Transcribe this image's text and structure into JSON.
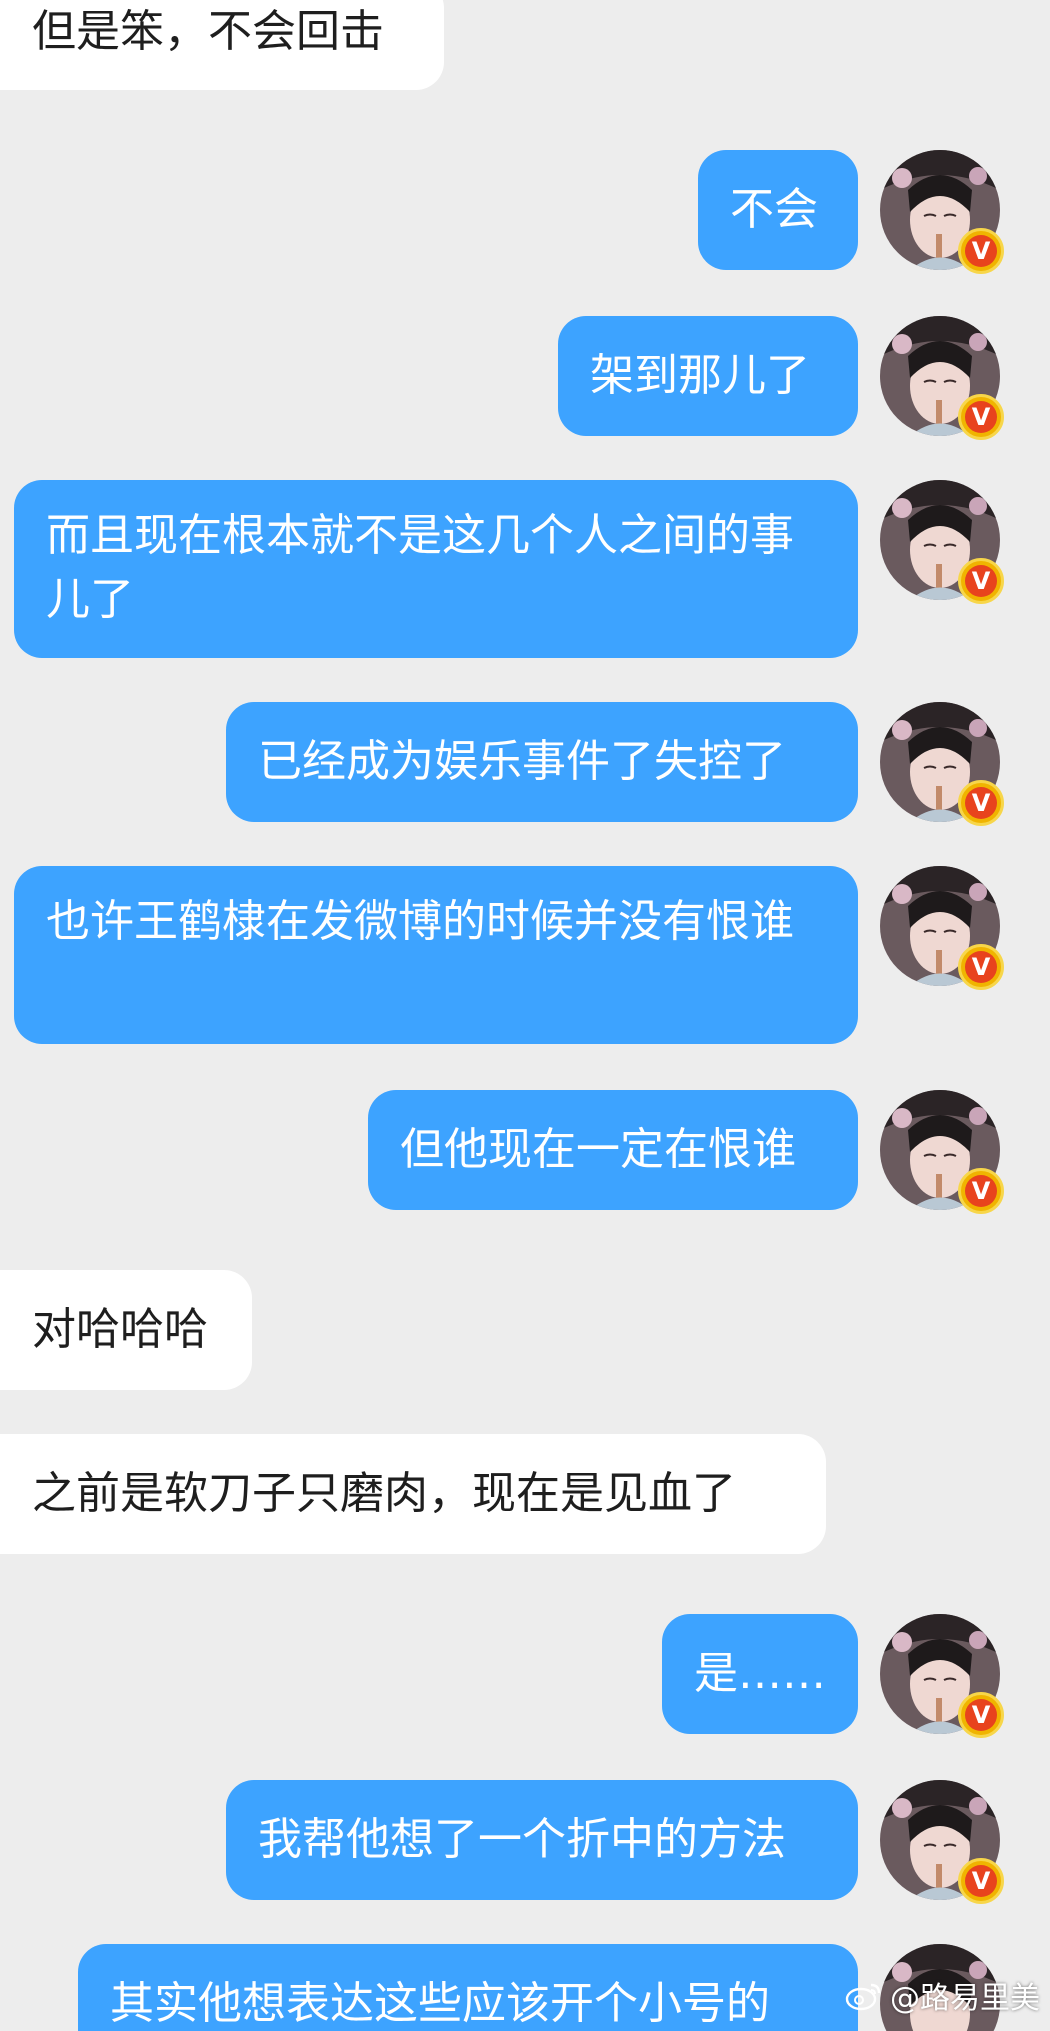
{
  "colors": {
    "background": "#ededed",
    "incoming_bubble": "#ffffff",
    "outgoing_bubble": "#3da3ff",
    "outgoing_text": "#ffffff",
    "incoming_text": "#1e1e1e",
    "badge_gold": "#f0b400",
    "badge_red": "#e8431d"
  },
  "avatar": {
    "icon": "portrait-avatar-icon",
    "badge_label": "V"
  },
  "messages": [
    {
      "side": "in",
      "text": "但是笨，不会回击"
    },
    {
      "side": "out",
      "text": "不会"
    },
    {
      "side": "out",
      "text": "架到那儿了"
    },
    {
      "side": "out",
      "text": "而且现在根本就不是这几个人之间的事儿了"
    },
    {
      "side": "out",
      "text": "已经成为娱乐事件了失控了"
    },
    {
      "side": "out",
      "text": "也许王鹤棣在发微博的时候并没有恨谁"
    },
    {
      "side": "out",
      "text": "但他现在一定在恨谁"
    },
    {
      "side": "in",
      "text": "对哈哈哈"
    },
    {
      "side": "in",
      "text": "之前是软刀子只磨肉，现在是见血了"
    },
    {
      "side": "out",
      "text": "是……"
    },
    {
      "side": "out",
      "text": "我帮他想了一个折中的方法"
    },
    {
      "side": "out",
      "text": "其实他想表达这些应该开个小号的"
    }
  ],
  "watermark": {
    "icon": "weibo-icon",
    "text": "@路易里美"
  }
}
